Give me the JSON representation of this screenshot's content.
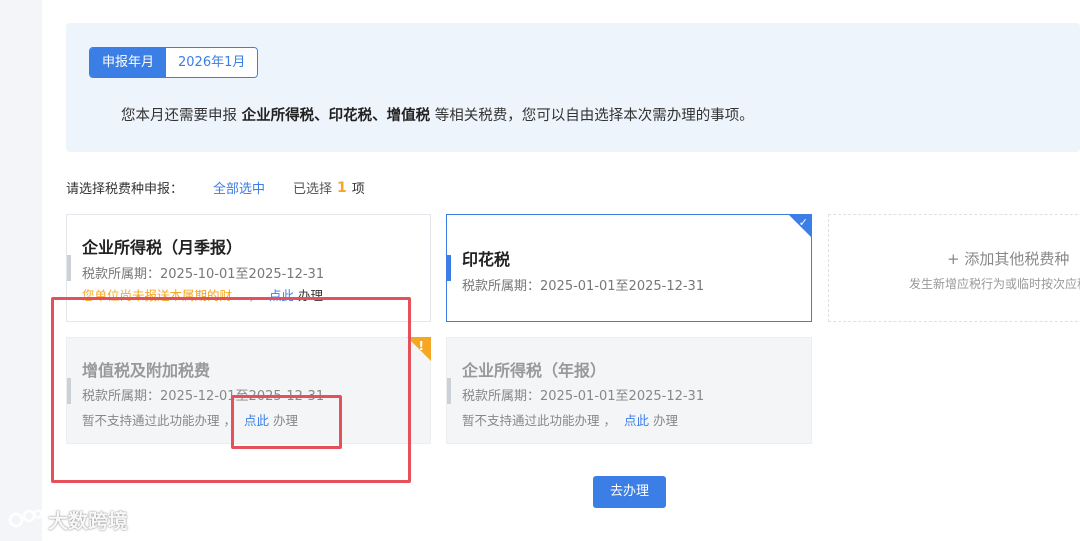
{
  "header": {
    "period_label": "申报年月",
    "period_value": "2026年1月",
    "notice_prefix": "您本月还需要申报",
    "notice_taxes": "企业所得税、印花税、增值税",
    "notice_suffix": "等相关税费，您可以自由选择本次需办理的事项。"
  },
  "selection": {
    "prompt": "请选择税费种申报：",
    "select_all": "全部选中",
    "selected_prefix": "已选择",
    "selected_count": "1",
    "selected_suffix": "项"
  },
  "cards": [
    {
      "title": "企业所得税（月季报）",
      "period": "税款所属期：2025-10-01至2025-12-31",
      "note_warn": "您单位尚未报送本属期的财…",
      "note_sep": "，",
      "link": "点此",
      "action": "办理",
      "selected": false
    },
    {
      "title": "印花税",
      "period": "税款所属期：2025-01-01至2025-12-31",
      "selected": true
    },
    {
      "title": "增值税及附加税费",
      "period": "税款所属期：2025-12-01至2025-12-31",
      "note": "暂不支持通过此功能办理",
      "note_sep": "，",
      "link": "点此",
      "action": "办理",
      "flag": "!"
    },
    {
      "title": "企业所得税（年报）",
      "period": "税款所属期：2025-01-01至2025-12-31",
      "note": "暂不支持通过此功能办理",
      "note_sep": "，",
      "link": "点此",
      "action": "办理"
    }
  ],
  "add_card": {
    "label": "+ 添加其他税费种",
    "hint": "发生新增应税行为或临时按次应税"
  },
  "actions": {
    "go_label": "去办理"
  },
  "watermark": {
    "text": "大数跨境"
  },
  "colors": {
    "accent": "#3a7ee6",
    "warning": "#f5a623",
    "annotation": "#e5505a"
  }
}
